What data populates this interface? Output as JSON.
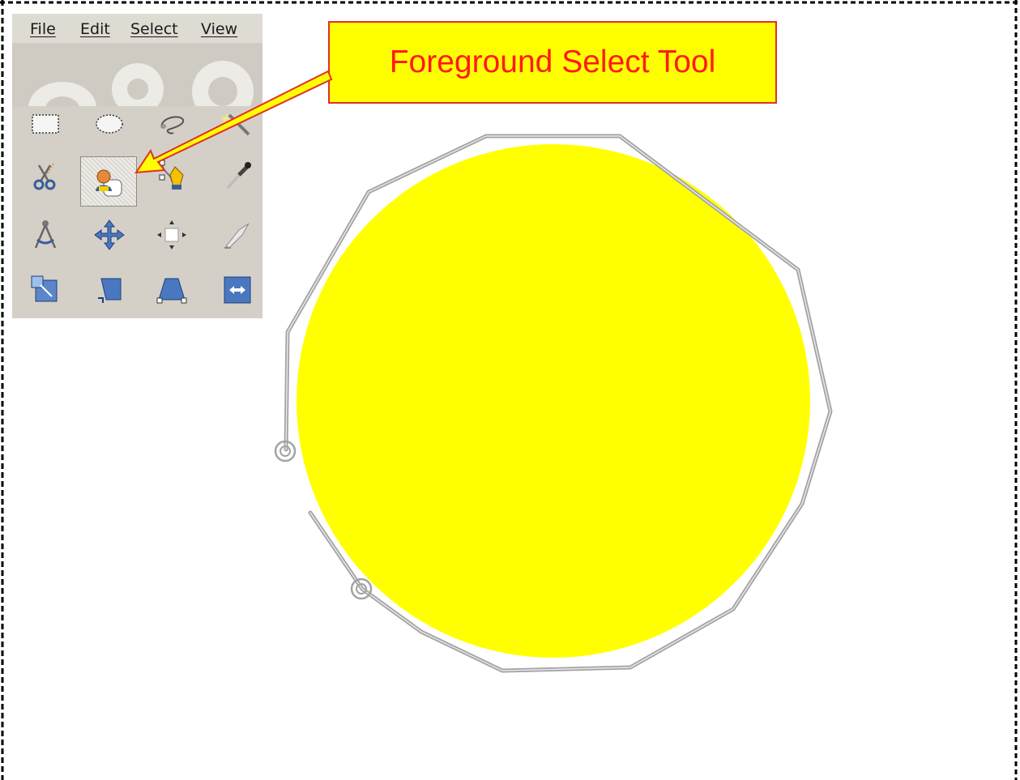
{
  "menu": {
    "file": "File",
    "edit": "Edit",
    "select": "Select",
    "view": "View"
  },
  "toolbox": {
    "tools_row1": [
      "rectangle-select",
      "ellipse-select",
      "free-select",
      "fuzzy-select"
    ],
    "tools_row2": [
      "scissors-select",
      "foreground-select",
      "paths",
      "color-picker"
    ],
    "tools_row3": [
      "measure",
      "move",
      "align",
      "crop"
    ],
    "tools_row4": [
      "rotate",
      "scale",
      "perspective",
      "flip"
    ],
    "active_tool": "foreground-select"
  },
  "callout": {
    "label": "Foreground Select Tool"
  },
  "colors": {
    "circle_fill": "#ffff00",
    "callout_fill": "#ffff00",
    "callout_text": "#ff1a1a",
    "callout_border": "#e0302a",
    "toolbox_bg": "#d4d0c8",
    "lasso_stroke": "#a8a8a8"
  }
}
